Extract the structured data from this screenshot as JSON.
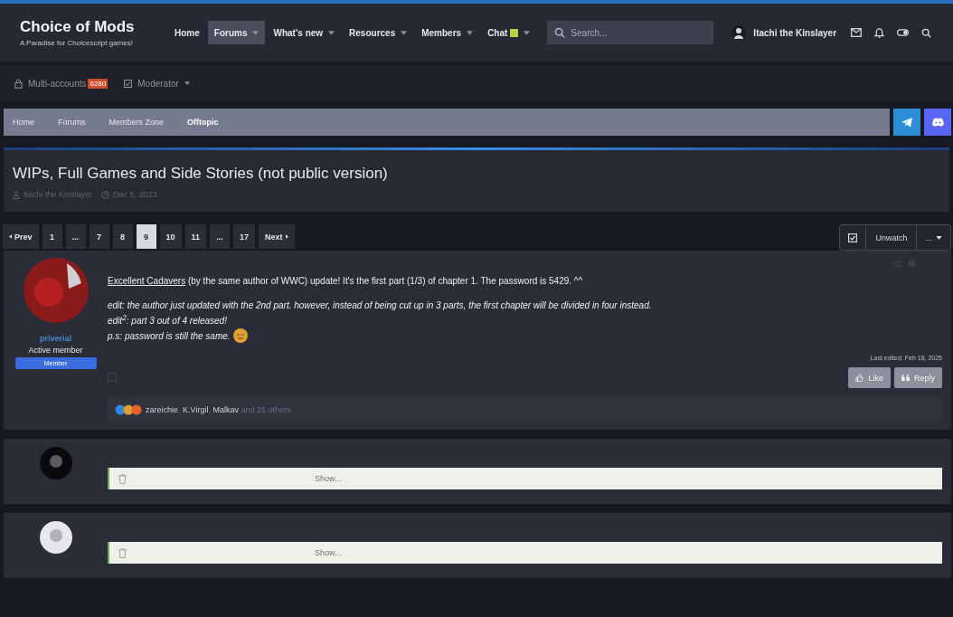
{
  "header": {
    "site_title": "Choice of Mods",
    "tagline": "A Paradise for Choicescript games!",
    "nav": [
      {
        "label": "Home",
        "selected": false,
        "has_menu": false,
        "kind": "plain"
      },
      {
        "label": "Forums",
        "selected": true,
        "has_menu": true,
        "kind": "plain"
      },
      {
        "label": "What's new",
        "selected": false,
        "has_menu": true,
        "kind": "plain"
      },
      {
        "label": "Resources",
        "selected": false,
        "has_menu": true,
        "kind": "plain"
      },
      {
        "label": "Members",
        "selected": false,
        "has_menu": true,
        "kind": "plain"
      },
      {
        "label": "Chat",
        "selected": false,
        "has_menu": true,
        "kind": "chat"
      }
    ],
    "search": {
      "placeholder": "Search..."
    },
    "user": "Itachi the Kinslayer"
  },
  "subnav": [
    {
      "label": "Multi-accounts",
      "badge": "6280",
      "kind": "lock"
    },
    {
      "label": "Moderator",
      "kind": "check"
    }
  ],
  "breadcrumbs": [
    {
      "label": "Home",
      "current": false
    },
    {
      "label": "Forums",
      "current": false
    },
    {
      "label": "Members Zone",
      "current": false
    },
    {
      "label": "Offtopic",
      "current": true
    }
  ],
  "thread": {
    "title": "WIPs, Full Games and Side Stories (not public version)",
    "author": "Itachi the Kinslayer",
    "date": "Dec 5, 2023"
  },
  "pagination": {
    "prev": "Prev",
    "next": "Next",
    "pages": [
      {
        "label": "1",
        "selected": false
      },
      {
        "label": "...",
        "selected": false
      },
      {
        "label": "7",
        "selected": false
      },
      {
        "label": "8",
        "selected": false
      },
      {
        "label": "9",
        "selected": true
      },
      {
        "label": "10",
        "selected": false
      },
      {
        "label": "11",
        "selected": false
      },
      {
        "label": "...",
        "selected": false
      },
      {
        "label": "17",
        "selected": false
      }
    ]
  },
  "thread_actions": {
    "unwatch": "Unwatch",
    "more": "..."
  },
  "posts": [
    {
      "kind": "message",
      "user": "priverial",
      "user_title": "Active member",
      "banner": "Member",
      "link": "Excellent Cadavers",
      "lead": "(by the same author of WWC) update! It's the first part (1/3) of chapter 1. The password is 5429. ^^",
      "lines": [
        "edit: the author just updated with the 2nd part. however, instead of being cut up in 3 parts, the first chapter will be divided in four instead.",
        "edit$^{2}$: part 3 out of 4 released!",
        "p.s: password is still the same."
      ],
      "last_edited": "Last edited: Feb 18, 2025",
      "like": "Like",
      "reply": "Reply",
      "reactions": "**zareichie**, **K.Virgil**, **Malkav** and 25 others"
    },
    {
      "kind": "deleted",
      "show": "Show..."
    },
    {
      "kind": "deleted",
      "show": "Show..."
    }
  ]
}
